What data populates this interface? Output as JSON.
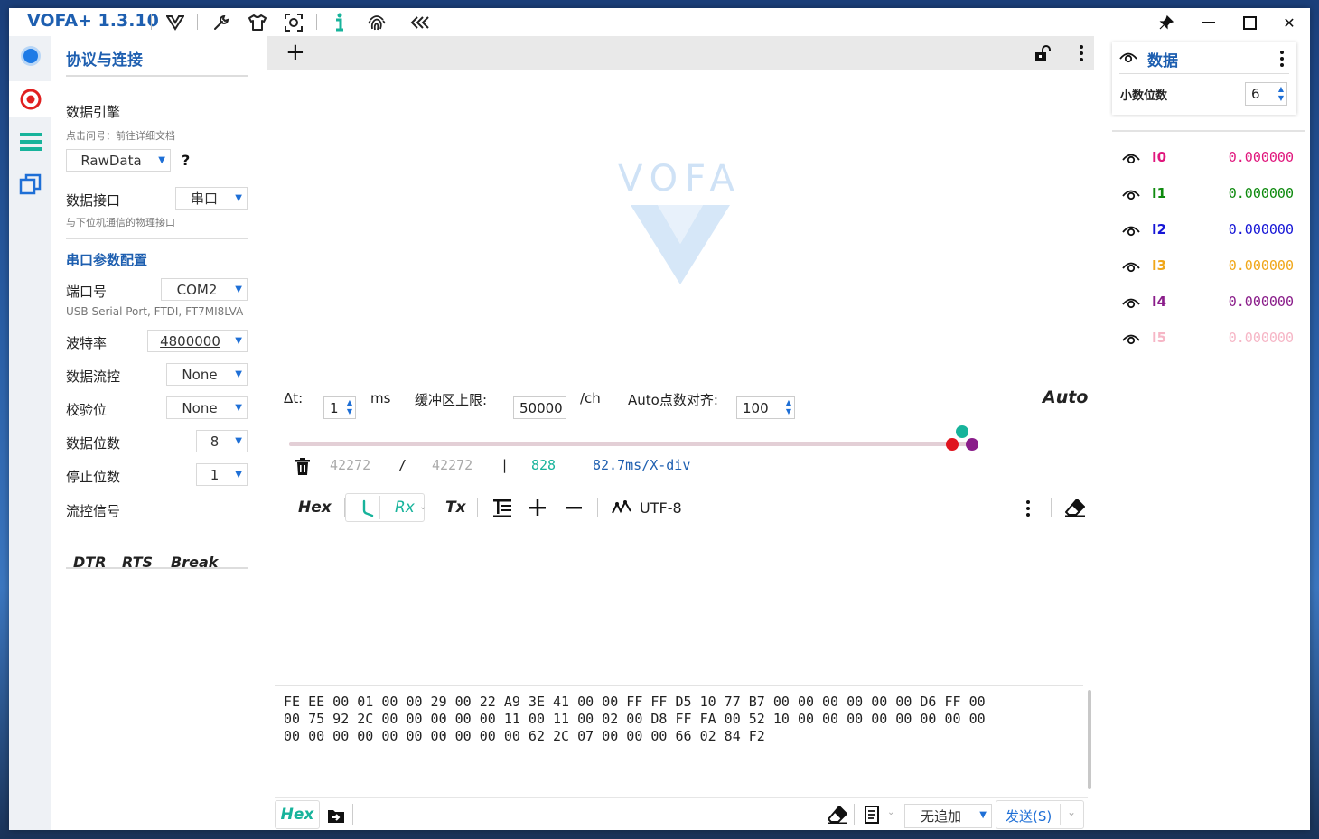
{
  "app": {
    "title": "VOFA+ 1.3.10"
  },
  "window": {
    "close_glyph": "✕"
  },
  "connection": {
    "title": "协议与连接",
    "engine_label": "数据引擎",
    "engine_hint": "点击问号：前往详细文档",
    "engine_value": "RawData",
    "help_mark": "?",
    "interface_label": "数据接口",
    "interface_value": "串口",
    "interface_hint": "与下位机通信的物理接口",
    "serial_section": "串口参数配置",
    "port_label": "端口号",
    "port_value": "COM2",
    "port_hint": "USB Serial Port, FTDI, FT7MI8LVA",
    "baud_label": "波特率",
    "baud_value": "4800000",
    "flow_label": "数据流控",
    "flow_value": "None",
    "parity_label": "校验位",
    "parity_value": "None",
    "databits_label": "数据位数",
    "databits_value": "8",
    "stopbits_label": "停止位数",
    "stopbits_value": "1",
    "flow_signal_label": "流控信号",
    "dtr": "DTR",
    "rts": "RTS",
    "brk": "Break"
  },
  "plot": {
    "add_glyph": "+",
    "watermark": "VOFA",
    "dt_label": "Δt:",
    "dt_value": "1",
    "dt_unit": "ms",
    "buffer_label": "缓冲区上限:",
    "buffer_value": "50000",
    "buffer_unit": "/ch",
    "align_label": "Auto点数对齐:",
    "align_value": "100",
    "auto": "Auto",
    "stat_a": "42272",
    "stat_sep1": "/",
    "stat_b": "42272",
    "stat_sep2": "|",
    "stat_c": "828",
    "stat_div": "82.7ms/X-div"
  },
  "terminal": {
    "hex": "Hex",
    "rx": "Rx",
    "tx": "Tx",
    "encoding": "UTF-8",
    "output": "FE EE 00 01 00 00 29 00 22 A9 3E 41 00 00 FF FF D5 10 77 B7 00 00 00 00 00 00 D6 FF 00\n00 75 92 2C 00 00 00 00 00 11 00 11 00 02 00 D8 FF FA 00 52 10 00 00 00 00 00 00 00 00\n00 00 00 00 00 00 00 00 00 00 62 2C 07 00 00 00 66 02 84 F2",
    "send_hex": "Hex",
    "append_value": "无追加",
    "send_label": "发送(S)"
  },
  "data_panel": {
    "title": "数据",
    "decimals_label": "小数位数",
    "decimals_value": "6",
    "channels": [
      {
        "name": "I0",
        "value": "0.000000",
        "color": "#e0177d"
      },
      {
        "name": "I1",
        "value": "0.000000",
        "color": "#0e8a0e"
      },
      {
        "name": "I2",
        "value": "0.000000",
        "color": "#1515d6"
      },
      {
        "name": "I3",
        "value": "0.000000",
        "color": "#f0a71a"
      },
      {
        "name": "I4",
        "value": "0.000000",
        "color": "#8a1d8a"
      },
      {
        "name": "I5",
        "value": "0.000000",
        "color": "#f6b6c6"
      }
    ]
  },
  "colors": {
    "accent": "#1e5fb0",
    "teal": "#17b39b"
  }
}
